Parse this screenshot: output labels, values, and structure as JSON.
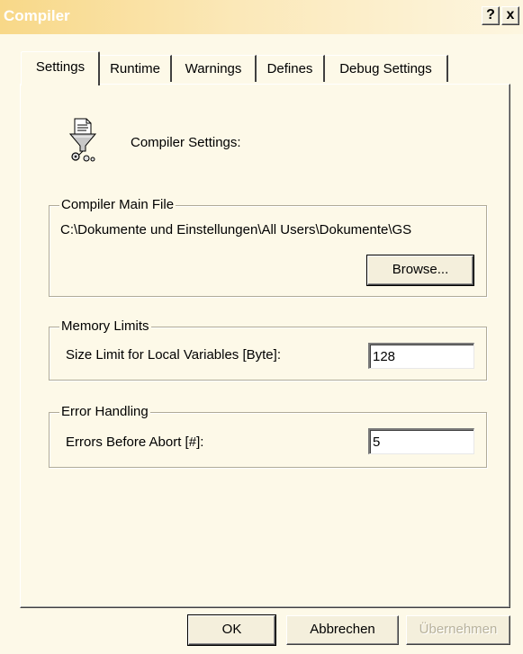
{
  "window": {
    "title": "Compiler",
    "help_label": "?",
    "close_label": "x"
  },
  "tabs": [
    "Settings",
    "Runtime",
    "Warnings",
    "Defines",
    "Debug Settings"
  ],
  "header": {
    "heading": "Compiler Settings:",
    "icon": "compiler-funnel-icon"
  },
  "main_file": {
    "legend": "Compiler Main File",
    "path": "C:\\Dokumente und Einstellungen\\All Users\\Dokumente\\GS",
    "browse_label": "Browse..."
  },
  "memory": {
    "legend": "Memory Limits",
    "label": "Size Limit for Local Variables [Byte]:",
    "value": "128"
  },
  "errors": {
    "legend": "Error Handling",
    "label": "Errors Before Abort [#]:",
    "value": "5"
  },
  "buttons": {
    "ok": "OK",
    "cancel": "Abbrechen",
    "apply": "Übernehmen"
  }
}
